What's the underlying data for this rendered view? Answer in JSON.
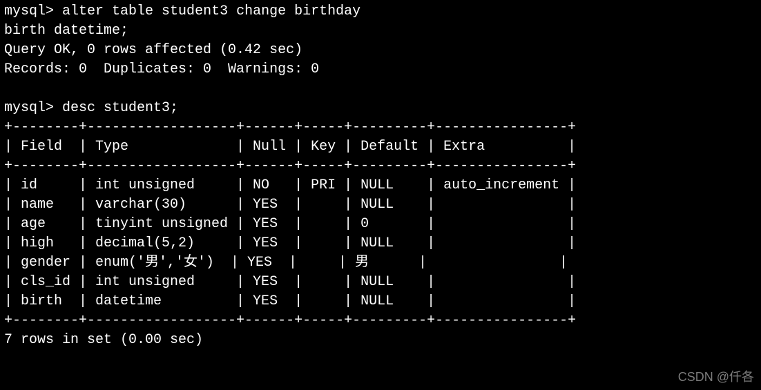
{
  "prompt": "mysql>",
  "cmd1_line1": "alter table student3 change birthday",
  "cmd1_line2": "birth datetime;",
  "result1_line1": "Query OK, 0 rows affected (0.42 sec)",
  "result1_line2": "Records: 0  Duplicates: 0  Warnings: 0",
  "cmd2": "desc student3;",
  "table": {
    "border": "+--------+------------------+------+-----+---------+----------------+",
    "headers": [
      "Field",
      "Type",
      "Null",
      "Key",
      "Default",
      "Extra"
    ],
    "rows": [
      {
        "Field": "id",
        "Type": "int unsigned",
        "Null": "NO",
        "Key": "PRI",
        "Default": "NULL",
        "Extra": "auto_increment"
      },
      {
        "Field": "name",
        "Type": "varchar(30)",
        "Null": "YES",
        "Key": "",
        "Default": "NULL",
        "Extra": ""
      },
      {
        "Field": "age",
        "Type": "tinyint unsigned",
        "Null": "YES",
        "Key": "",
        "Default": "0",
        "Extra": ""
      },
      {
        "Field": "high",
        "Type": "decimal(5,2)",
        "Null": "YES",
        "Key": "",
        "Default": "NULL",
        "Extra": ""
      },
      {
        "Field": "gender",
        "Type": "enum('男','女')",
        "Null": "YES",
        "Key": "",
        "Default": "男",
        "Extra": ""
      },
      {
        "Field": "cls_id",
        "Type": "int unsigned",
        "Null": "YES",
        "Key": "",
        "Default": "NULL",
        "Extra": ""
      },
      {
        "Field": "birth",
        "Type": "datetime",
        "Null": "YES",
        "Key": "",
        "Default": "NULL",
        "Extra": ""
      }
    ]
  },
  "footer": "7 rows in set (0.00 sec)",
  "chart_data": {
    "type": "table",
    "title": "desc student3",
    "columns": [
      "Field",
      "Type",
      "Null",
      "Key",
      "Default",
      "Extra"
    ],
    "rows": [
      [
        "id",
        "int unsigned",
        "NO",
        "PRI",
        "NULL",
        "auto_increment"
      ],
      [
        "name",
        "varchar(30)",
        "YES",
        "",
        "NULL",
        ""
      ],
      [
        "age",
        "tinyint unsigned",
        "YES",
        "",
        "0",
        ""
      ],
      [
        "high",
        "decimal(5,2)",
        "YES",
        "",
        "NULL",
        ""
      ],
      [
        "gender",
        "enum('男','女')",
        "YES",
        "",
        "男",
        ""
      ],
      [
        "cls_id",
        "int unsigned",
        "YES",
        "",
        "NULL",
        ""
      ],
      [
        "birth",
        "datetime",
        "YES",
        "",
        "NULL",
        ""
      ]
    ]
  },
  "watermark": "CSDN @仟各"
}
